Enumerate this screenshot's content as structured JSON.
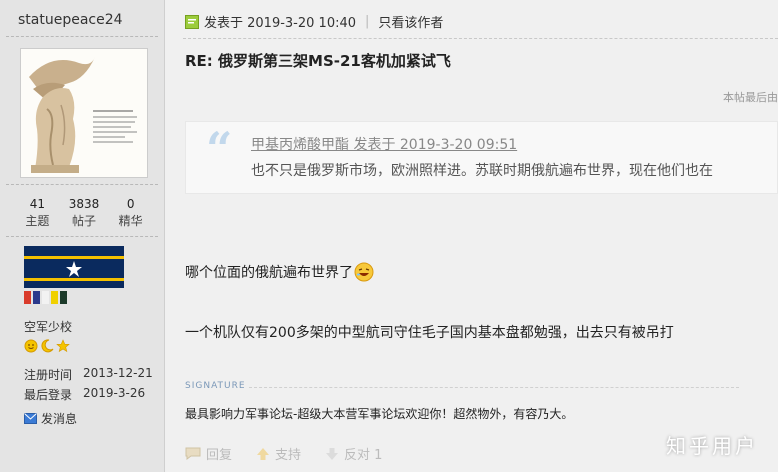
{
  "author": {
    "username": "statuepeace24",
    "stats": [
      {
        "value": "41",
        "label": "主题"
      },
      {
        "value": "3838",
        "label": "帖子"
      },
      {
        "value": "0",
        "label": "精华"
      }
    ],
    "rank": "空军少校",
    "register_label": "注册时间",
    "register_date": "2013-12-21",
    "last_login_label": "最后登录",
    "last_login_date": "2019-3-26",
    "pm_label": "发消息",
    "flag_colors": [
      "#0a2a5e",
      "#f3c000",
      "#ffffff"
    ],
    "color_bars": [
      "#d93b2b",
      "#2b3a8c",
      "#f2f2f2",
      "#f0d000",
      "#1c3a2a"
    ]
  },
  "post": {
    "posted_at": "发表于 2019-3-20 10:40",
    "author_only": "只看该作者",
    "title": "RE: 俄罗斯第三架MS-21客机加紧试飞",
    "edit_note": "本帖最后由",
    "quote": {
      "header": "甲基丙烯酸甲酯 发表于 2019-3-20 09:51",
      "body": "也不只是俄罗斯市场，欧洲照样进。苏联时期俄航遍布世界，现在他们也在"
    },
    "body_lines": [
      "哪个位面的俄航遍布世界了",
      "一个机队仅有200多架的中型航司守住毛子国内基本盘都勉强，出去只有被吊打"
    ],
    "signature_label": "SIGNATURE",
    "signature_text": "最具影响力军事论坛-超级大本营军事论坛欢迎你！超然物外，有容乃大。",
    "actions": {
      "reply": "回复",
      "support": "支持",
      "oppose": "反对 1"
    }
  },
  "watermark": "知乎用户"
}
